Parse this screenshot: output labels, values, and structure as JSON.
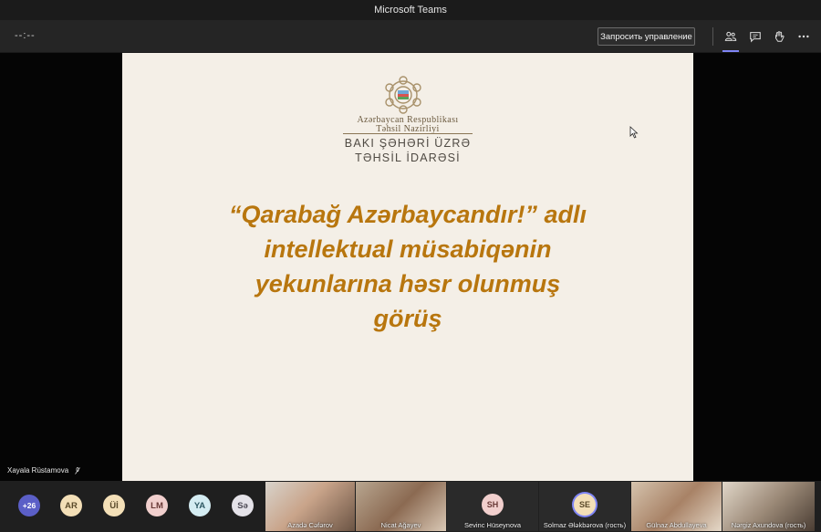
{
  "window": {
    "title": "Microsoft Teams"
  },
  "toolbar": {
    "timer": "--:--",
    "request_control_label": "Запросить управление",
    "icons": [
      "participants-icon",
      "chat-icon",
      "raise-hand-icon",
      "more-icon"
    ]
  },
  "slide": {
    "org_line1": "Azərbaycan Respublikası",
    "org_line2": "Təhsil Nazirliyi",
    "dept_line1": "BAKI ŞƏHƏRİ ÜZRƏ",
    "dept_line2": "TƏHSİL İDARƏSİ",
    "headline": [
      "“Qarabağ Azərbaycandır!” adlı",
      "intellektual müsabiqənin",
      "yekunlarına həsr olunmuş",
      "görüş"
    ]
  },
  "presenter": {
    "name": "Xayala Rüstamova"
  },
  "participants": {
    "more_count": "+26",
    "avatars": [
      {
        "initials": "AR",
        "style": "light"
      },
      {
        "initials": "Üİ",
        "style": "light"
      },
      {
        "initials": "LM",
        "style": "pink"
      },
      {
        "initials": "YA",
        "style": "cyan"
      },
      {
        "initials": "Sə",
        "style": "gray"
      }
    ],
    "tiles": [
      {
        "name": "Azadə Cəfərov",
        "kind": "video"
      },
      {
        "name": "Nicat Ağayev",
        "kind": "video"
      },
      {
        "name": "Sevinc Hüseynova",
        "kind": "avatar",
        "initials": "SH"
      },
      {
        "name": "Solmaz Ələkbərova (гость)",
        "kind": "avatar",
        "initials": "SE"
      },
      {
        "name": "Gülnaz Abdullayeva",
        "kind": "video"
      },
      {
        "name": "Nərgiz Axundova (гость)",
        "kind": "video"
      }
    ]
  },
  "colors": {
    "accent": "#7f85f5",
    "headline": "#b8760e",
    "slide_bg": "#f4efe7"
  }
}
